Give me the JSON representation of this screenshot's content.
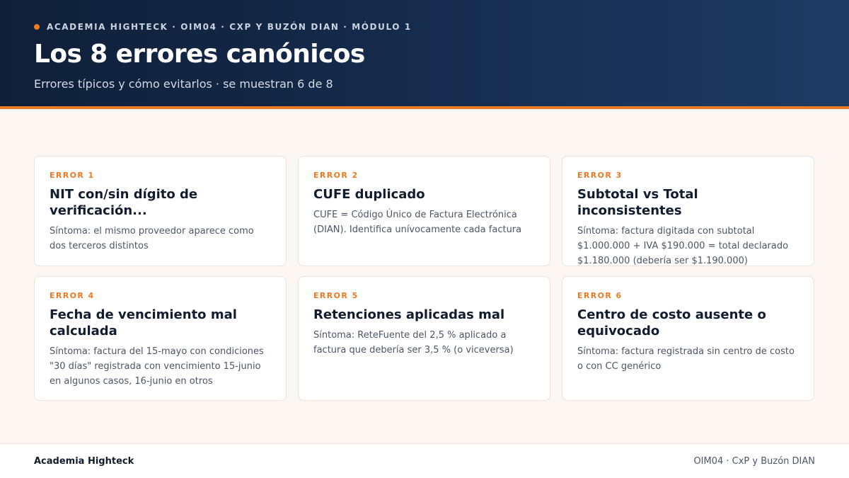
{
  "header": {
    "eyebrow": "ACADEMIA HIGHTECK · OIM04 · CXP Y BUZÓN DIAN · MÓDULO 1",
    "title": "Los 8 errores canónicos",
    "subtitle": "Errores típicos y cómo evitarlos · se muestran 6 de 8"
  },
  "cards": [
    {
      "label": "ERROR 1",
      "title": "NIT con/sin dígito de verificación...",
      "text": "Síntoma: el mismo proveedor aparece como dos terceros distintos"
    },
    {
      "label": "ERROR 2",
      "title": "CUFE duplicado",
      "text": "CUFE = Código Único de Factura Electrónica (DIAN). Identifica unívocamente cada factura"
    },
    {
      "label": "ERROR 3",
      "title": "Subtotal vs Total inconsistentes",
      "text": "Síntoma: factura digitada con subtotal $1.000.000 + IVA $190.000 = total declarado $1.180.000 (debería ser $1.190.000)"
    },
    {
      "label": "ERROR 4",
      "title": "Fecha de vencimiento mal calculada",
      "text": "Síntoma: factura del 15-mayo con condiciones \"30 días\" registrada con vencimiento 15-junio en algunos casos, 16-junio en otros"
    },
    {
      "label": "ERROR 5",
      "title": "Retenciones aplicadas mal",
      "text": "Síntoma: ReteFuente del 2,5 % aplicado a factura que debería ser 3,5 % (o viceversa)"
    },
    {
      "label": "ERROR 6",
      "title": "Centro de costo ausente o equivocado",
      "text": "Síntoma: factura registrada sin centro de costo o con CC genérico"
    }
  ],
  "footer": {
    "left": "Academia Highteck",
    "right": "OIM04 · CxP y Buzón DIAN"
  },
  "colors": {
    "accent": "#ec7a22",
    "header_bg": "#0f1f38",
    "page_bg": "#fcf7f2"
  }
}
